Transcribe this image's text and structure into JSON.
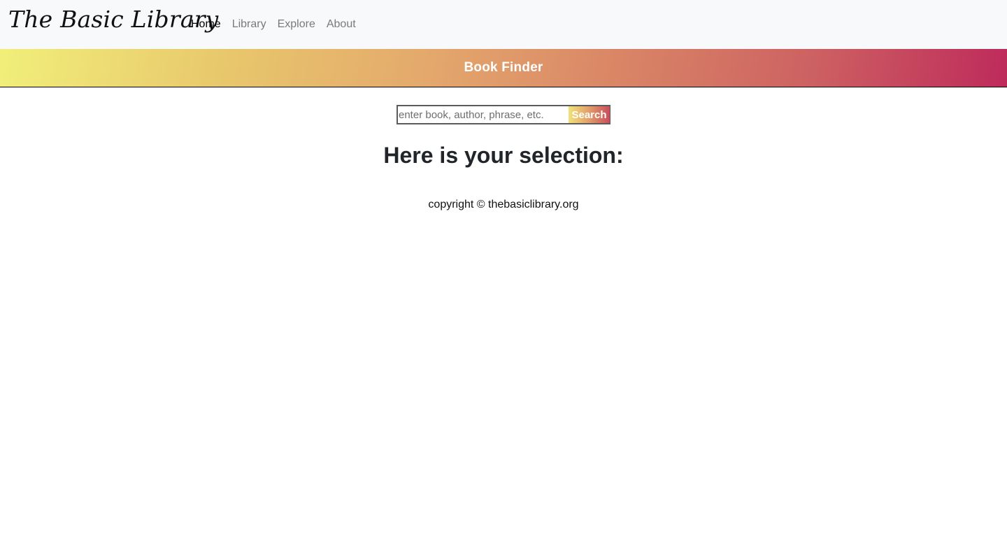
{
  "navbar": {
    "brand": "The Basic Library",
    "links": [
      {
        "label": "Home",
        "active": true
      },
      {
        "label": "Library",
        "active": false
      },
      {
        "label": "Explore",
        "active": false
      },
      {
        "label": "About",
        "active": false
      }
    ]
  },
  "banner": {
    "title": "Book Finder",
    "gradient_colors": [
      "#f1ef7a",
      "#e4a96c",
      "#d98466",
      "#be2a5b"
    ]
  },
  "search": {
    "placeholder": "enter book, author, phrase, etc.",
    "value": "",
    "button_label": "Search"
  },
  "main": {
    "heading": "Here is your selection:"
  },
  "footer": {
    "copyright": "copyright © thebasiclibrary.org"
  }
}
